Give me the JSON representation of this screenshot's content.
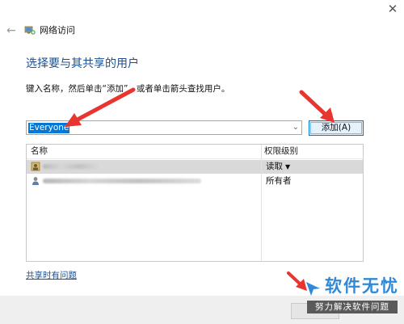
{
  "window": {
    "title": "网络访问",
    "close_glyph": "✕",
    "back_glyph": "←"
  },
  "main": {
    "heading": "选择要与其共享的用户",
    "instruction": "键入名称，然后单击“添加”，或者单击箭头查找用户。",
    "input_value": "Everyone",
    "add_button_label": "添加(A)"
  },
  "table": {
    "columns": [
      "名称",
      "权限级别"
    ],
    "rows": [
      {
        "permission": "读取",
        "has_dropdown": true,
        "selected": true
      },
      {
        "permission": "所有者",
        "has_dropdown": false,
        "selected": false
      }
    ]
  },
  "footer": {
    "share_link": "共享时有问题"
  },
  "watermark": {
    "title": "软件无忧",
    "subtitle": "努力解决软件问题"
  },
  "colors": {
    "accent": "#0078d7",
    "heading": "#1a4f91",
    "annotation": "#e8352f",
    "watermark": "#2f89d8"
  }
}
